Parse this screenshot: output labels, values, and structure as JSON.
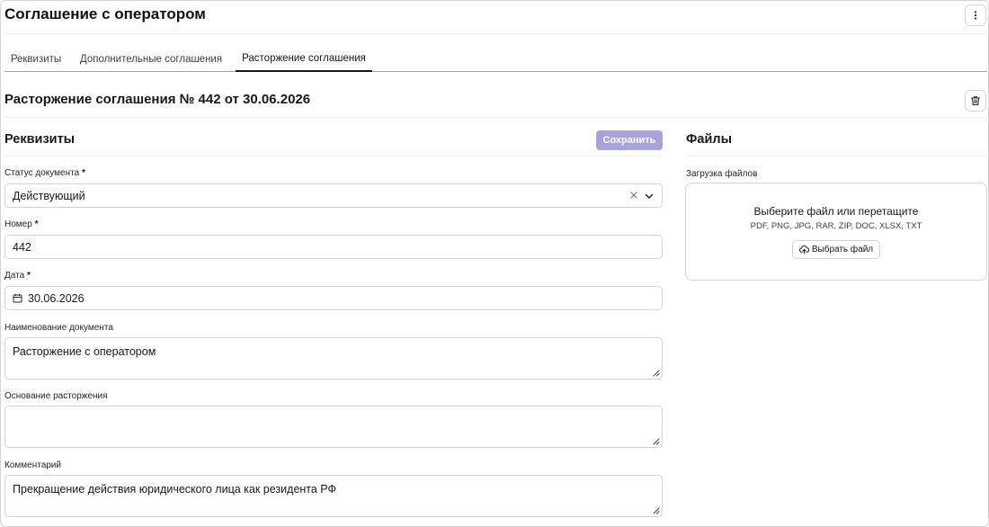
{
  "header": {
    "title": "Соглашение с оператором"
  },
  "tabs": [
    {
      "label": "Реквизиты"
    },
    {
      "label": "Дополнительные соглашения"
    },
    {
      "label": "Расторжение соглашения"
    }
  ],
  "active_tab": "Расторжение соглашения",
  "section": {
    "title": "Расторжение соглашения № 442 от 30.06.2026"
  },
  "requisites": {
    "title": "Реквизиты",
    "save_label": "Сохранить",
    "status": {
      "label": "Статус документа",
      "required_mark": "*",
      "value": "Действующий"
    },
    "number": {
      "label": "Номер",
      "required_mark": "*",
      "value": "442"
    },
    "date": {
      "label": "Дата",
      "required_mark": "*",
      "value": "30.06.2026"
    },
    "doc_name": {
      "label": "Наименование документа",
      "value": "Расторжение с оператором"
    },
    "reason": {
      "label": "Основание расторжения",
      "value": ""
    },
    "comment": {
      "label": "Комментарий",
      "value": "Прекращение действия юридического лица как резидента РФ"
    }
  },
  "files": {
    "title": "Файлы",
    "upload_label": "Загрузка файлов",
    "drop_title": "Выберите файл или перетащите",
    "allowed_types": "PDF, PNG, JPG, RAR, ZIP, DOC, XLSX, TXT",
    "choose_label": "Выбрать файл"
  },
  "colors": {
    "accent_disabled": "#a8a4da",
    "border": "#d4d4d8",
    "text": "#18181b"
  },
  "icons": [
    "more-vertical-icon",
    "trash-icon",
    "clear-icon",
    "chevron-down-icon",
    "calendar-icon",
    "resize-handle-icon",
    "upload-cloud-icon"
  ]
}
